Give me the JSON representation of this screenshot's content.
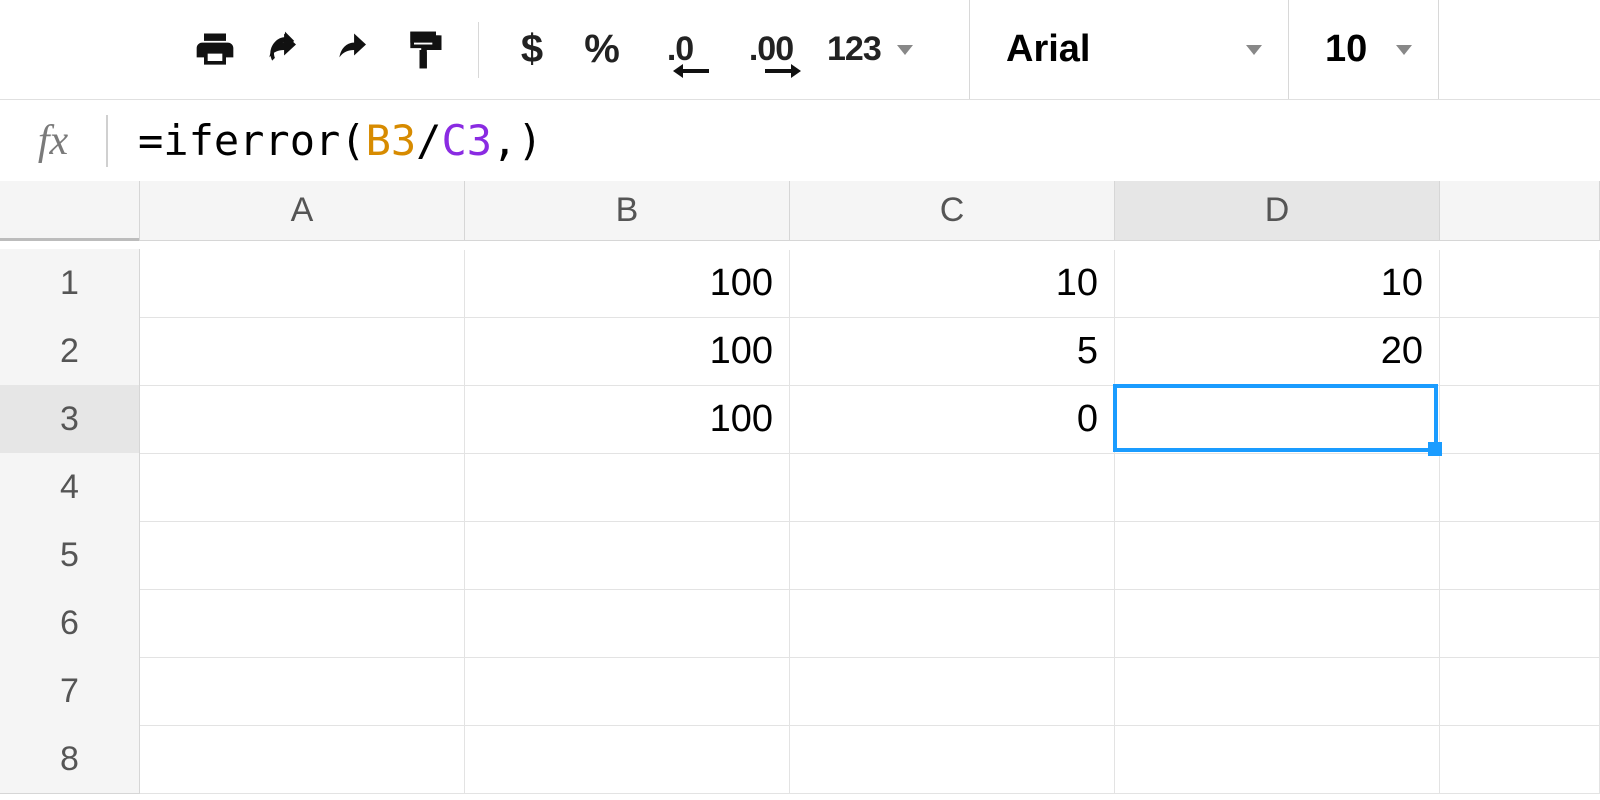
{
  "toolbar": {
    "currency_label": "$",
    "percent_label": "%",
    "dec_less_label": ".0",
    "dec_more_label": ".00",
    "number_format_label": "123",
    "font_name": "Arial",
    "font_size": "10"
  },
  "formula_bar": {
    "prefix": "=iferror(",
    "ref1": "B3",
    "op": "/",
    "ref2": "C3",
    "suffix": ",)"
  },
  "columns": [
    "A",
    "B",
    "C",
    "D"
  ],
  "rows": [
    "1",
    "2",
    "3",
    "4",
    "5",
    "6",
    "7",
    "8"
  ],
  "cells": {
    "B1": "100",
    "C1": "10",
    "D1": "10",
    "B2": "100",
    "C2": "5",
    "D2": "20",
    "B3": "100",
    "C3": "0",
    "D3": ""
  },
  "active_cell": "D3",
  "chart_data": {
    "type": "table",
    "columns": [
      "A",
      "B",
      "C",
      "D"
    ],
    "rows": [
      {
        "row": 1,
        "A": "",
        "B": 100,
        "C": 10,
        "D": 10
      },
      {
        "row": 2,
        "A": "",
        "B": 100,
        "C": 5,
        "D": 20
      },
      {
        "row": 3,
        "A": "",
        "B": 100,
        "C": 0,
        "D": null
      }
    ],
    "formula_D3": "=iferror(B3/C3,)"
  }
}
